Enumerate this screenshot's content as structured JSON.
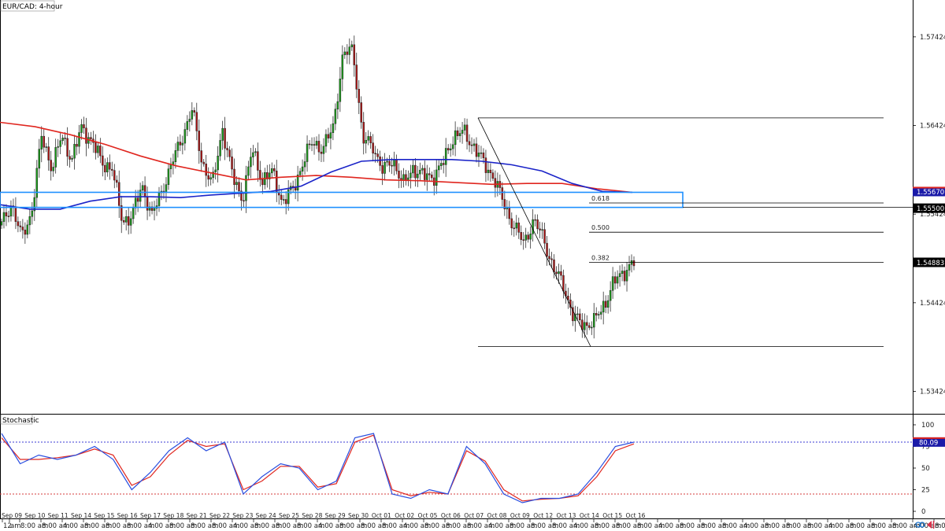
{
  "chart_title": "EUR/CAD: 4-hour",
  "indicator_title": "Stochastic",
  "colors": {
    "up": "#1aa01a",
    "down": "#b01818",
    "ma_fast": "#1a23c8",
    "ma_slow": "#e0261f",
    "zone": "#1e90ff",
    "stoch_k": "#2a4fe0",
    "stoch_d": "#e0261f",
    "overbought": "#3b3bd6",
    "oversold": "#d63b3b"
  },
  "price_axis": [
    "1.57424",
    "1.56424",
    "1.55424",
    "1.54424",
    "1.53424"
  ],
  "stoch_axis": [
    "100",
    "75",
    "50",
    "25",
    "0"
  ],
  "price_tags": [
    {
      "text": "1.55670",
      "style": "red"
    },
    {
      "text": "1.55500",
      "style": "black"
    },
    {
      "text": "1.54883",
      "style": "black"
    }
  ],
  "stoch_tags": [
    {
      "text": "80.09",
      "style": "blue"
    }
  ],
  "fib_labels": [
    "0.618",
    "0.500",
    "0.382"
  ],
  "time_labels": [
    "12",
    "am",
    "8:00 am",
    "8:00 am",
    "4:00 am",
    "8:00 am",
    "8:00 am",
    "8:00 am",
    "4:00 am",
    "8:00 am",
    "8:00 am",
    "8:00 am",
    "4:00 am",
    "8:00 am",
    "8:00 am",
    "8:00 am",
    "4:00 am",
    "8:00 am",
    "8:00 am",
    "8:00 am",
    "4:00 am",
    "8:00 am",
    "8:00 am",
    "8:00 am",
    "4:00 am",
    "8:00 am",
    "8:00 am",
    "8:00 am",
    "4:00 am",
    "8:00 am",
    "8:00 am",
    "8:00 am",
    "4:00 am",
    "8:00 am",
    "8:00 am",
    "8:00 am",
    "4:00 am",
    "8:00 am",
    "8:00 am",
    "8:00 am",
    "4:00 am",
    "8:00 am",
    "8:00 am",
    "8:00 am",
    "4:00 am",
    "8:00 am",
    "8:00 am",
    "8:00 am",
    "4:00 am",
    "8:00 am",
    "8:00 am",
    "8:00 am",
    "4:00 am",
    "8:00 am",
    "8:00 am",
    "8:00 am",
    "4:00 am",
    "8:00 am",
    "8:00 am",
    "8:00 am",
    "4:00 am",
    "8:00 am"
  ],
  "chart_data": {
    "type": "candlestick",
    "title": "EUR/CAD: 4-hour",
    "dates": [
      "Sep 09",
      "Sep 10",
      "Sep 11",
      "Sep 14",
      "Sep 15",
      "Sep 16",
      "Sep 17",
      "Sep 18",
      "Sep 21",
      "Sep 22",
      "Sep 23",
      "Sep 24",
      "Sep 25",
      "Sep 28",
      "Sep 29",
      "Sep 30",
      "Oct 01",
      "Oct 02",
      "Oct 05",
      "Oct 06",
      "Oct 07",
      "Oct 08",
      "Oct 09",
      "Oct 12",
      "Oct 13",
      "Oct 14",
      "Oct 15",
      "Oct 16"
    ],
    "ylim": [
      1.5318,
      1.5784
    ],
    "close_path": [
      1.553,
      1.5555,
      1.5515,
      1.5545,
      1.563,
      1.5595,
      1.563,
      1.5605,
      1.564,
      1.5625,
      1.56,
      1.5595,
      1.5535,
      1.554,
      1.5575,
      1.554,
      1.557,
      1.56,
      1.563,
      1.566,
      1.56,
      1.5575,
      1.564,
      1.5585,
      1.556,
      1.5615,
      1.558,
      1.559,
      1.5555,
      1.557,
      1.56,
      1.5625,
      1.5615,
      1.564,
      1.572,
      1.573,
      1.5625,
      1.562,
      1.559,
      1.5605,
      1.5575,
      1.5595,
      1.5585,
      1.5585,
      1.56,
      1.563,
      1.5635,
      1.562,
      1.56,
      1.5585,
      1.5555,
      1.553,
      1.551,
      1.5535,
      1.5515,
      1.548,
      1.5462,
      1.5425,
      1.5418,
      1.542,
      1.544,
      1.5465,
      1.5478,
      1.5488
    ],
    "ma_fast": [
      1.5553,
      1.5548,
      1.5548,
      1.5557,
      1.5562,
      1.5562,
      1.5561,
      1.5564,
      1.5566,
      1.5568,
      1.5574,
      1.559,
      1.5602,
      1.5604,
      1.5604,
      1.5604,
      1.5602,
      1.5598,
      1.5591,
      1.5577,
      1.5568,
      1.5567
    ],
    "ma_slow": [
      1.5646,
      1.5641,
      1.5632,
      1.5621,
      1.5608,
      1.5597,
      1.5589,
      1.5581,
      1.5584,
      1.5586,
      1.5584,
      1.5581,
      1.558,
      1.5578,
      1.5576,
      1.5577,
      1.5577,
      1.5571,
      1.5567
    ],
    "levels": [
      {
        "label": "zone_top",
        "value": 1.5567
      },
      {
        "label": "zone_bottom",
        "value": 1.555
      },
      {
        "label": "swing_high",
        "value": 1.5651
      },
      {
        "label": "0.618",
        "value": 1.5555
      },
      {
        "label": "0.500",
        "value": 1.5522
      },
      {
        "label": "0.382",
        "value": 1.5488
      },
      {
        "label": "swing_low",
        "value": 1.5393
      }
    ],
    "stochastic": {
      "k": [
        90,
        55,
        65,
        60,
        65,
        75,
        60,
        25,
        45,
        70,
        85,
        70,
        80,
        20,
        40,
        55,
        50,
        25,
        35,
        85,
        90,
        20,
        15,
        25,
        20,
        75,
        55,
        20,
        10,
        15,
        15,
        20,
        45,
        75,
        80
      ],
      "d": [
        85,
        60,
        60,
        62,
        65,
        72,
        65,
        30,
        40,
        65,
        82,
        75,
        78,
        25,
        35,
        52,
        52,
        28,
        32,
        80,
        88,
        25,
        18,
        22,
        20,
        70,
        58,
        25,
        12,
        14,
        15,
        18,
        40,
        70,
        78
      ],
      "overbought": 80,
      "oversold": 20,
      "ylim": [
        0,
        100
      ],
      "last_value": 80.09
    }
  }
}
